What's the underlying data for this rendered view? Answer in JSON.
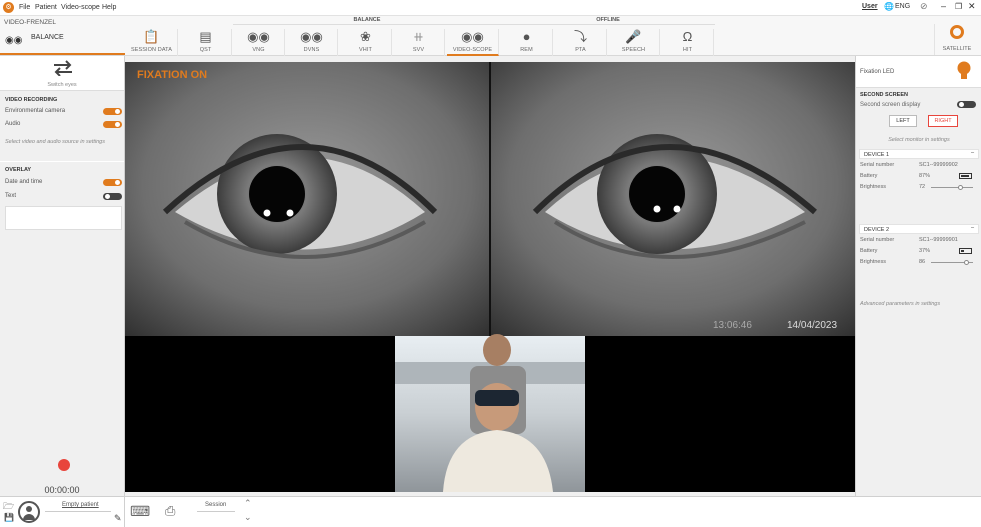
{
  "menubar": {
    "items": [
      "File",
      "Patient",
      "Video-scope",
      "Help"
    ],
    "user_label": "User",
    "language": "ENG"
  },
  "header": {
    "app_name": "VIDEO-FRENZEL",
    "mode_label": "BALANCE",
    "groups": {
      "balance": "BALANCE",
      "offline": "OFFLINE"
    },
    "tools": [
      {
        "label": "SESSION DATA"
      },
      {
        "label": "QST"
      },
      {
        "label": "VNG"
      },
      {
        "label": "DVNS"
      },
      {
        "label": "VHIT"
      },
      {
        "label": "SVV"
      },
      {
        "label": "VIDEO-SCOPE"
      },
      {
        "label": "REM"
      },
      {
        "label": "PTA"
      },
      {
        "label": "SPEECH"
      },
      {
        "label": "HIT"
      }
    ],
    "satellite_label": "SATELLITE",
    "accent": "#e07b1e"
  },
  "left_panel": {
    "switch_label": "Switch eyes",
    "video_recording_title": "VIDEO RECORDING",
    "env_camera_label": "Environmental camera",
    "audio_label": "Audio",
    "source_hint": "Select video and audio source in settings",
    "overlay_title": "OVERLAY",
    "date_time_label": "Date and time",
    "text_label": "Text",
    "timer": "00:00:00"
  },
  "video": {
    "fixation_label": "FIXATION ON",
    "time_overlay": "13:06:46",
    "date_overlay": "14/04/2023"
  },
  "right_panel": {
    "fixation_led_label": "Fixation LED",
    "second_screen_title": "SECOND SCREEN",
    "second_screen_display_label": "Second screen display",
    "left_button": "LEFT",
    "right_button": "RIGHT",
    "monitor_hint": "Select monitor in settings",
    "serial_label": "Serial number",
    "battery_label": "Battery",
    "brightness_label": "Brightness",
    "devices": [
      {
        "title": "DEVICE 1",
        "serial": "SC1--99999902",
        "battery": "87%",
        "brightness": "72",
        "battery_fraction": 0.87,
        "brightness_fraction": 0.72
      },
      {
        "title": "DEVICE 2",
        "serial": "SC1--99999901",
        "battery": "37%",
        "brightness": "86",
        "battery_fraction": 0.37,
        "brightness_fraction": 0.86
      }
    ],
    "advanced_hint": "Advanced parameters in settings"
  },
  "bottom": {
    "patient_label": "Empty patient",
    "session_label": "Session"
  }
}
